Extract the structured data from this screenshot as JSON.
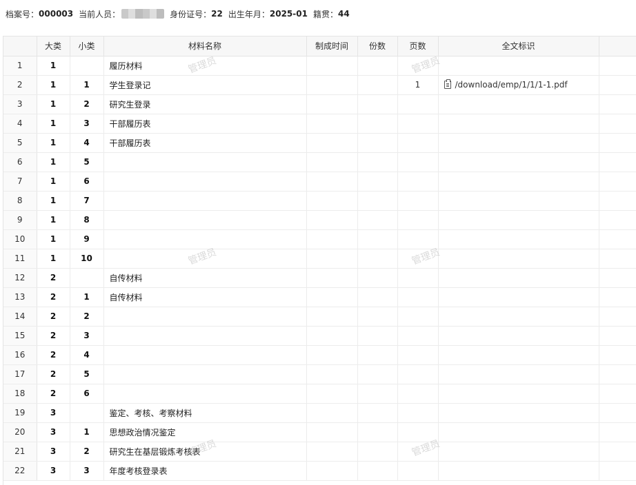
{
  "info": {
    "archive_label": "档案号：",
    "archive_no": "000003",
    "person_label": "当前人员：",
    "id_label": "身份证号：",
    "id_no": "22",
    "birth_label": "出生年月：",
    "birth": "2025-01",
    "native_label": "籍贯：",
    "native": "44"
  },
  "table": {
    "headers": [
      "大类",
      "小类",
      "材料名称",
      "制成时间",
      "份数",
      "页数",
      "全文标识"
    ],
    "rows": [
      {
        "idx": "1",
        "cat": "1",
        "sub": "",
        "name": "履历材料",
        "time": "",
        "copies": "",
        "pages": "",
        "file": ""
      },
      {
        "idx": "2",
        "cat": "1",
        "sub": "1",
        "name": "学生登录记",
        "time": "",
        "copies": "",
        "pages": "1",
        "file": "/download/emp/1/1/1-1.pdf"
      },
      {
        "idx": "3",
        "cat": "1",
        "sub": "2",
        "name": "研究生登录",
        "time": "",
        "copies": "",
        "pages": "",
        "file": ""
      },
      {
        "idx": "4",
        "cat": "1",
        "sub": "3",
        "name": "干部履历表",
        "time": "",
        "copies": "",
        "pages": "",
        "file": ""
      },
      {
        "idx": "5",
        "cat": "1",
        "sub": "4",
        "name": "干部履历表",
        "time": "",
        "copies": "",
        "pages": "",
        "file": ""
      },
      {
        "idx": "6",
        "cat": "1",
        "sub": "5",
        "name": "",
        "time": "",
        "copies": "",
        "pages": "",
        "file": ""
      },
      {
        "idx": "7",
        "cat": "1",
        "sub": "6",
        "name": "",
        "time": "",
        "copies": "",
        "pages": "",
        "file": ""
      },
      {
        "idx": "8",
        "cat": "1",
        "sub": "7",
        "name": "",
        "time": "",
        "copies": "",
        "pages": "",
        "file": ""
      },
      {
        "idx": "9",
        "cat": "1",
        "sub": "8",
        "name": "",
        "time": "",
        "copies": "",
        "pages": "",
        "file": ""
      },
      {
        "idx": "10",
        "cat": "1",
        "sub": "9",
        "name": "",
        "time": "",
        "copies": "",
        "pages": "",
        "file": ""
      },
      {
        "idx": "11",
        "cat": "1",
        "sub": "10",
        "name": "",
        "time": "",
        "copies": "",
        "pages": "",
        "file": ""
      },
      {
        "idx": "12",
        "cat": "2",
        "sub": "",
        "name": "自传材料",
        "time": "",
        "copies": "",
        "pages": "",
        "file": ""
      },
      {
        "idx": "13",
        "cat": "2",
        "sub": "1",
        "name": "自传材料",
        "time": "",
        "copies": "",
        "pages": "",
        "file": ""
      },
      {
        "idx": "14",
        "cat": "2",
        "sub": "2",
        "name": "",
        "time": "",
        "copies": "",
        "pages": "",
        "file": ""
      },
      {
        "idx": "15",
        "cat": "2",
        "sub": "3",
        "name": "",
        "time": "",
        "copies": "",
        "pages": "",
        "file": ""
      },
      {
        "idx": "16",
        "cat": "2",
        "sub": "4",
        "name": "",
        "time": "",
        "copies": "",
        "pages": "",
        "file": ""
      },
      {
        "idx": "17",
        "cat": "2",
        "sub": "5",
        "name": "",
        "time": "",
        "copies": "",
        "pages": "",
        "file": ""
      },
      {
        "idx": "18",
        "cat": "2",
        "sub": "6",
        "name": "",
        "time": "",
        "copies": "",
        "pages": "",
        "file": ""
      },
      {
        "idx": "19",
        "cat": "3",
        "sub": "",
        "name": "鉴定、考核、考察材料",
        "time": "",
        "copies": "",
        "pages": "",
        "file": ""
      },
      {
        "idx": "20",
        "cat": "3",
        "sub": "1",
        "name": "思想政治情况鉴定",
        "time": "",
        "copies": "",
        "pages": "",
        "file": ""
      },
      {
        "idx": "21",
        "cat": "3",
        "sub": "2",
        "name": "研究生在基层锻炼考核表",
        "time": "",
        "copies": "",
        "pages": "",
        "file": ""
      },
      {
        "idx": "22",
        "cat": "3",
        "sub": "3",
        "name": "年度考核登录表",
        "time": "",
        "copies": "",
        "pages": "",
        "file": ""
      }
    ]
  },
  "watermark": "管理员",
  "icons": {
    "file": "clipboard-file-icon"
  }
}
